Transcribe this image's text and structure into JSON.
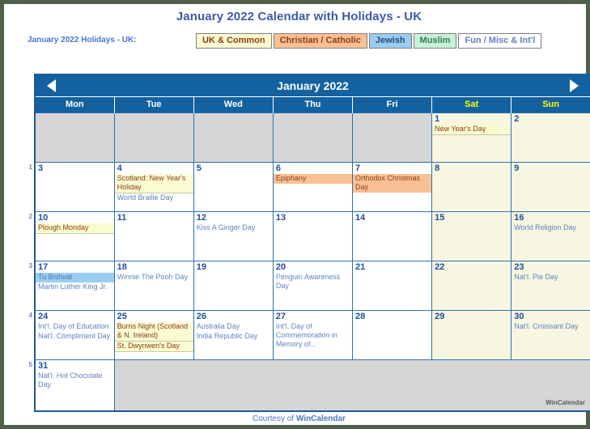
{
  "title": "January 2022 Calendar with Holidays - UK",
  "legend": {
    "caption": "January 2022 Holidays - UK:",
    "chips": [
      {
        "label": "UK & Common",
        "bg": "#fbfbd2",
        "fg": "#8c3b14"
      },
      {
        "label": "Christian / Catholic",
        "bg": "#f9c193",
        "fg": "#8c3b14"
      },
      {
        "label": "Jewish",
        "bg": "#9bcdf2",
        "fg": "#1f4e79"
      },
      {
        "label": "Muslim",
        "bg": "#c7f2d8",
        "fg": "#2e7d57"
      },
      {
        "label": "Fun / Misc & Int'l",
        "bg": "#ffffff",
        "fg": "#5e83bd"
      }
    ]
  },
  "calendar": {
    "month_title": "January 2022",
    "prev_icon": "left-triangle-icon",
    "next_icon": "right-triangle-icon",
    "weekday_headers": [
      {
        "label": "Mon",
        "weekend": false
      },
      {
        "label": "Tue",
        "weekend": false
      },
      {
        "label": "Wed",
        "weekend": false
      },
      {
        "label": "Thu",
        "weekend": false
      },
      {
        "label": "Fri",
        "weekend": false
      },
      {
        "label": "Sat",
        "weekend": true
      },
      {
        "label": "Sun",
        "weekend": true
      }
    ],
    "week_numbers": [
      "1",
      "2",
      "3",
      "4",
      "5"
    ],
    "weeks": [
      {
        "days": [
          {
            "num": "",
            "blank": true,
            "weekend": false,
            "events": []
          },
          {
            "num": "",
            "blank": true,
            "weekend": false,
            "events": []
          },
          {
            "num": "",
            "blank": true,
            "weekend": false,
            "events": []
          },
          {
            "num": "",
            "blank": true,
            "weekend": false,
            "events": []
          },
          {
            "num": "",
            "blank": true,
            "weekend": false,
            "events": []
          },
          {
            "num": "1",
            "blank": false,
            "weekend": true,
            "events": [
              {
                "text": "New Year's Day",
                "cat": "uk"
              }
            ]
          },
          {
            "num": "2",
            "blank": false,
            "weekend": true,
            "events": []
          }
        ]
      },
      {
        "days": [
          {
            "num": "3",
            "blank": false,
            "weekend": false,
            "events": []
          },
          {
            "num": "4",
            "blank": false,
            "weekend": false,
            "events": [
              {
                "text": "Scotland: New Year's Holiday",
                "cat": "uk"
              },
              {
                "text": "World Braille Day",
                "cat": "fun"
              }
            ]
          },
          {
            "num": "5",
            "blank": false,
            "weekend": false,
            "events": []
          },
          {
            "num": "6",
            "blank": false,
            "weekend": false,
            "events": [
              {
                "text": "Epiphany",
                "cat": "chr"
              }
            ]
          },
          {
            "num": "7",
            "blank": false,
            "weekend": false,
            "events": [
              {
                "text": "Orthodox Christmas Day",
                "cat": "chr"
              }
            ]
          },
          {
            "num": "8",
            "blank": false,
            "weekend": true,
            "events": []
          },
          {
            "num": "9",
            "blank": false,
            "weekend": true,
            "events": []
          }
        ]
      },
      {
        "days": [
          {
            "num": "10",
            "blank": false,
            "weekend": false,
            "events": [
              {
                "text": "Plough Monday",
                "cat": "uk"
              }
            ]
          },
          {
            "num": "11",
            "blank": false,
            "weekend": false,
            "events": []
          },
          {
            "num": "12",
            "blank": false,
            "weekend": false,
            "events": [
              {
                "text": "Kiss A Ginger Day",
                "cat": "fun"
              }
            ]
          },
          {
            "num": "13",
            "blank": false,
            "weekend": false,
            "events": []
          },
          {
            "num": "14",
            "blank": false,
            "weekend": false,
            "events": []
          },
          {
            "num": "15",
            "blank": false,
            "weekend": true,
            "events": []
          },
          {
            "num": "16",
            "blank": false,
            "weekend": true,
            "events": [
              {
                "text": "World Religion Day",
                "cat": "fun"
              }
            ]
          }
        ]
      },
      {
        "days": [
          {
            "num": "17",
            "blank": false,
            "weekend": false,
            "events": [
              {
                "text": "Tu Bishvat",
                "cat": "jew"
              },
              {
                "text": "Martin Luther King Jr.",
                "cat": "fun"
              }
            ]
          },
          {
            "num": "18",
            "blank": false,
            "weekend": false,
            "events": [
              {
                "text": "Winnie The Pooh Day",
                "cat": "fun"
              }
            ]
          },
          {
            "num": "19",
            "blank": false,
            "weekend": false,
            "events": []
          },
          {
            "num": "20",
            "blank": false,
            "weekend": false,
            "events": [
              {
                "text": "Penguin Awareness Day",
                "cat": "fun"
              }
            ]
          },
          {
            "num": "21",
            "blank": false,
            "weekend": false,
            "events": []
          },
          {
            "num": "22",
            "blank": false,
            "weekend": true,
            "events": []
          },
          {
            "num": "23",
            "blank": false,
            "weekend": true,
            "events": [
              {
                "text": "Nat'l. Pie Day",
                "cat": "fun"
              }
            ]
          }
        ]
      },
      {
        "days": [
          {
            "num": "24",
            "blank": false,
            "weekend": false,
            "events": [
              {
                "text": "Int'l. Day of Education",
                "cat": "fun"
              },
              {
                "text": "Nat'l. Compliment Day",
                "cat": "fun"
              }
            ]
          },
          {
            "num": "25",
            "blank": false,
            "weekend": false,
            "events": [
              {
                "text": "Burns Night (Scotland & N. Ireland)",
                "cat": "uk"
              },
              {
                "text": "St. Dwynwen's Day",
                "cat": "uk"
              }
            ]
          },
          {
            "num": "26",
            "blank": false,
            "weekend": false,
            "events": [
              {
                "text": "Australia Day",
                "cat": "fun"
              },
              {
                "text": "India Republic Day",
                "cat": "fun"
              }
            ]
          },
          {
            "num": "27",
            "blank": false,
            "weekend": false,
            "events": [
              {
                "text": "Int'l. Day of Commemoration in Memory of...",
                "cat": "fun"
              }
            ]
          },
          {
            "num": "28",
            "blank": false,
            "weekend": false,
            "events": []
          },
          {
            "num": "29",
            "blank": false,
            "weekend": true,
            "events": []
          },
          {
            "num": "30",
            "blank": false,
            "weekend": true,
            "events": [
              {
                "text": "Nat'l. Croissant Day",
                "cat": "fun"
              }
            ]
          }
        ]
      }
    ],
    "last_week": {
      "week_number": "5",
      "day": {
        "num": "31",
        "events": [
          {
            "text": "Nat'l. Hot Chocolate Day",
            "cat": "fun"
          }
        ]
      },
      "watermark": "WinCalendar"
    }
  },
  "footer": {
    "prefix": "Courtesy of ",
    "brand": "WinCalendar"
  }
}
